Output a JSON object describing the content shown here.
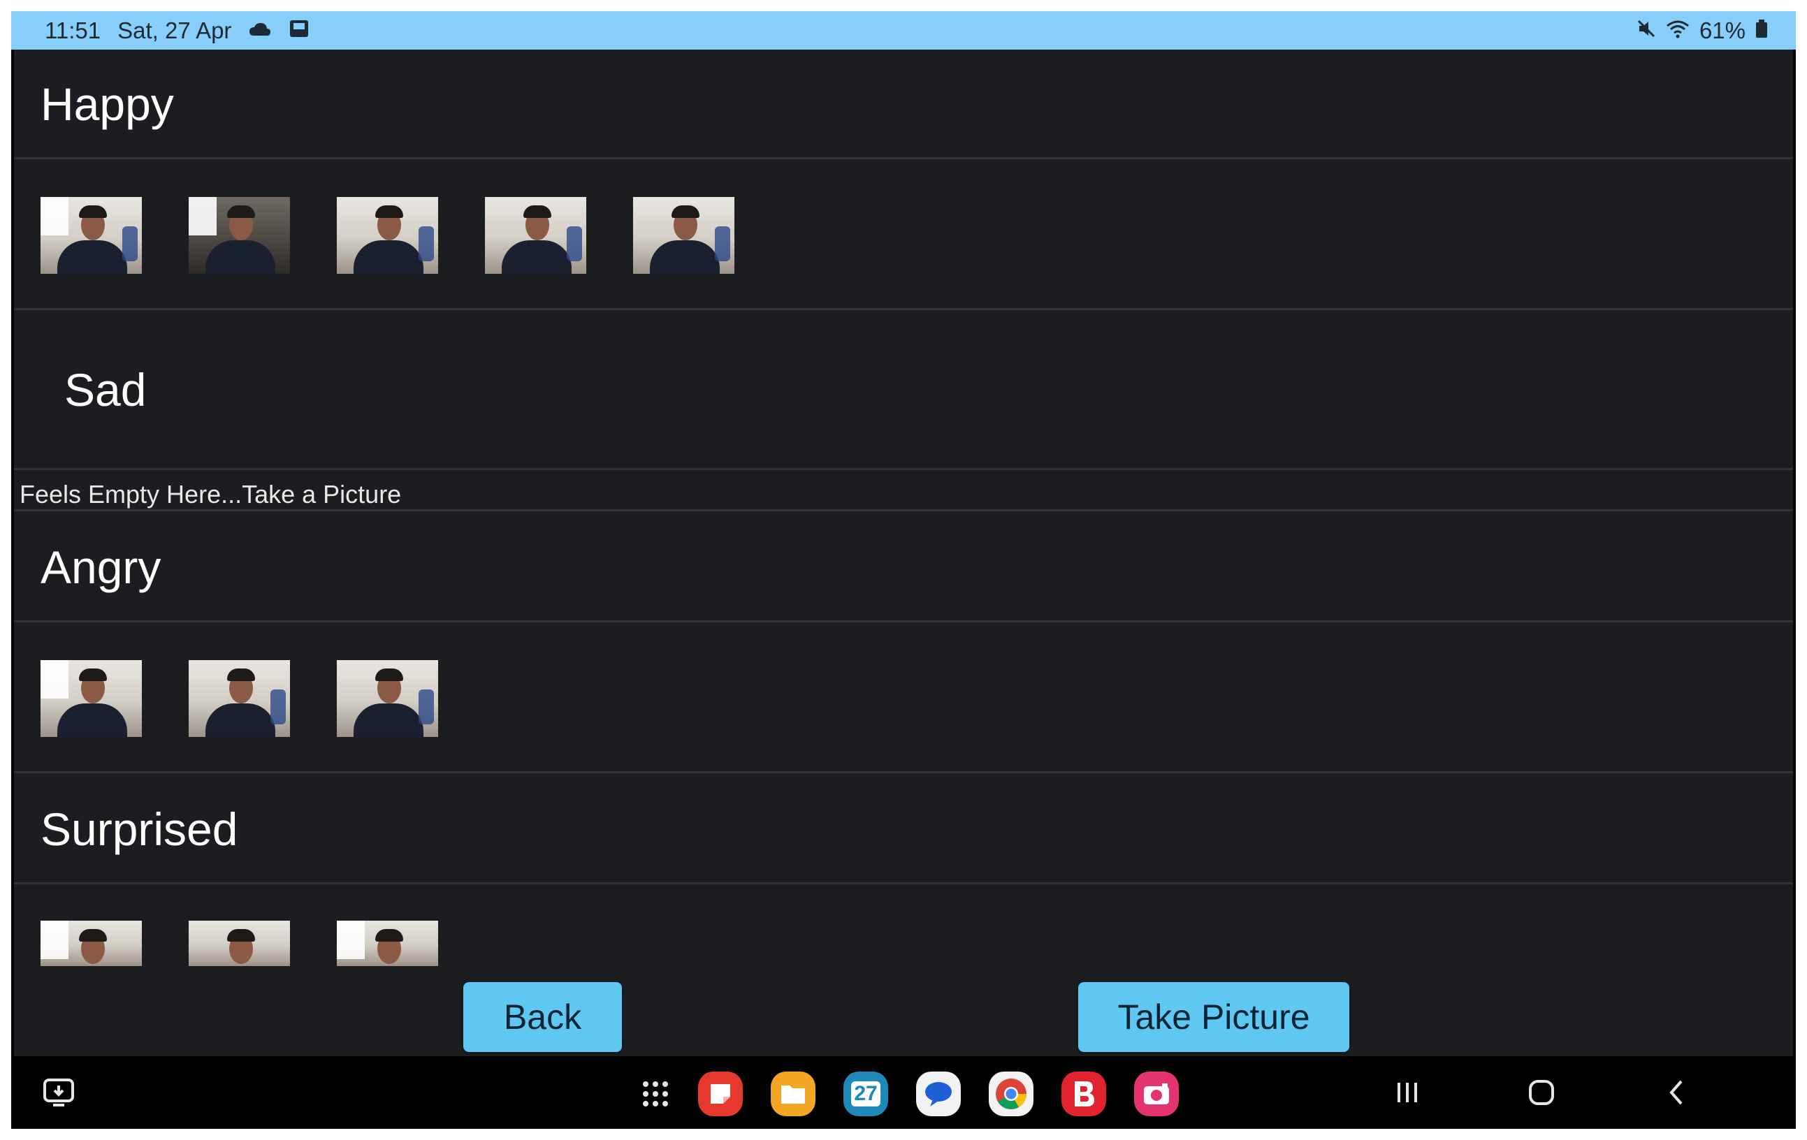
{
  "status_bar": {
    "time": "11:51",
    "date": "Sat, 27 Apr",
    "battery": "61%",
    "icons": [
      "cloud-icon",
      "screenshot-icon",
      "mute-icon",
      "wifi-icon",
      "battery-icon"
    ]
  },
  "sections": [
    {
      "title": "Happy",
      "thumbnail_count": 5
    },
    {
      "title": "Sad",
      "empty_message": "Feels Empty Here...Take a Picture"
    },
    {
      "title": "Angry",
      "thumbnail_count": 3
    },
    {
      "title": "Surprised",
      "thumbnail_count": 3
    }
  ],
  "buttons": {
    "back": "Back",
    "take_picture": "Take Picture"
  },
  "dock": {
    "calendar_day": "27",
    "apps": [
      "app-drawer-icon",
      "notes-app-icon",
      "files-app-icon",
      "calendar-app-icon",
      "messages-app-icon",
      "chrome-app-icon",
      "b-app-icon",
      "camera-app-icon"
    ]
  },
  "navigation": [
    "recents-icon",
    "home-icon",
    "back-nav-icon"
  ],
  "colors": {
    "status_bar": "#87cefa",
    "background": "#1b1d21",
    "button": "#5ec8f2",
    "divider": "#2f3236"
  }
}
